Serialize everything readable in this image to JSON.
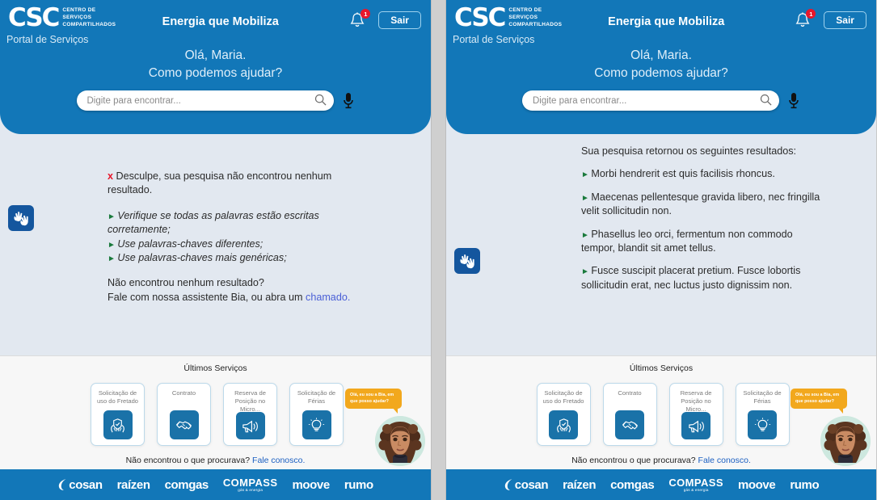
{
  "header": {
    "logo_main": "CSC",
    "logo_sub_lines": [
      "CENTRO DE",
      "SERVIÇOS",
      "COMPARTILHADOS"
    ],
    "brand_tagline": "Energia que Mobiliza",
    "portal_label": "Portal de Serviços",
    "notification_count": "1",
    "logout_label": "Sair",
    "greeting_line1": "Olá, Maria.",
    "greeting_line2": "Como podemos ajudar?",
    "search_placeholder": "Digite para encontrar...",
    "search_value": "",
    "icons": {
      "bell": "bell-icon",
      "search": "search-icon",
      "mic": "microphone-icon",
      "accessibility": "sign-language-accessibility-icon"
    }
  },
  "left_panel": {
    "error_mark": "x",
    "error_text": "Desculpe, sua pesquisa não encontrou nenhum resultado.",
    "tips": [
      "Verifique se todas as palavras estão escritas corretamente;",
      "Use palavras-chaves diferentes;",
      "Use palavras-chaves mais genéricas;"
    ],
    "footer_question": "Não encontrou nenhum resultado?",
    "footer_prefix": "Fale com nossa assistente Bia, ou abra um ",
    "footer_link": "chamado."
  },
  "right_panel": {
    "results_heading": "Sua pesquisa retornou os seguintes resultados:",
    "results": [
      "Morbi hendrerit est quis facilisis rhoncus.",
      "Maecenas pellentesque gravida libero, nec fringilla velit sollicitudin non.",
      "Phasellus leo orci, fermentum non commodo tempor, blandit sit amet tellus.",
      "Fusce suscipit placerat pretium. Fusce lobortis sollicitudin erat, nec luctus justo dignissim non."
    ]
  },
  "services": {
    "title": "Últimos Serviços",
    "cards": [
      {
        "label": "Solicitação de uso do Fretado",
        "icon": "hands-shield-icon"
      },
      {
        "label": "Contrato",
        "icon": "handshake-icon"
      },
      {
        "label": "Reserva de Posição no Micro...",
        "icon": "megaphone-icon"
      },
      {
        "label": "Solicitação de Férias",
        "icon": "lightbulb-icon"
      }
    ],
    "not_found_text": "Não encontrou o que procurava? ",
    "not_found_link": "Fale conosco.",
    "assistant": {
      "bubble_text": "Olá, eu sou a Bia, em que posso ajudar?",
      "avatar_name": "bia-assistant-avatar"
    }
  },
  "footer": {
    "brands": [
      {
        "name": "cosan",
        "style": "swoosh"
      },
      {
        "name": "raízen",
        "style": "plain"
      },
      {
        "name": "comgas",
        "style": "plain"
      },
      {
        "name": "COMPASS",
        "sub": "gás & energia",
        "style": "stacked"
      },
      {
        "name": "moove",
        "style": "plain"
      },
      {
        "name": "rumo",
        "style": "plain"
      }
    ]
  },
  "colors": {
    "brand_blue": "#1277B8",
    "icon_blue": "#1A72A8",
    "content_bg": "#E2E8F0",
    "services_bg": "#F7F7F7",
    "error_red": "#E8172B",
    "bullet_green": "#1A7A3C",
    "link_purple": "#4A5FD6",
    "link_blue": "#1B5FC1",
    "bubble_orange": "#F2A81D"
  }
}
